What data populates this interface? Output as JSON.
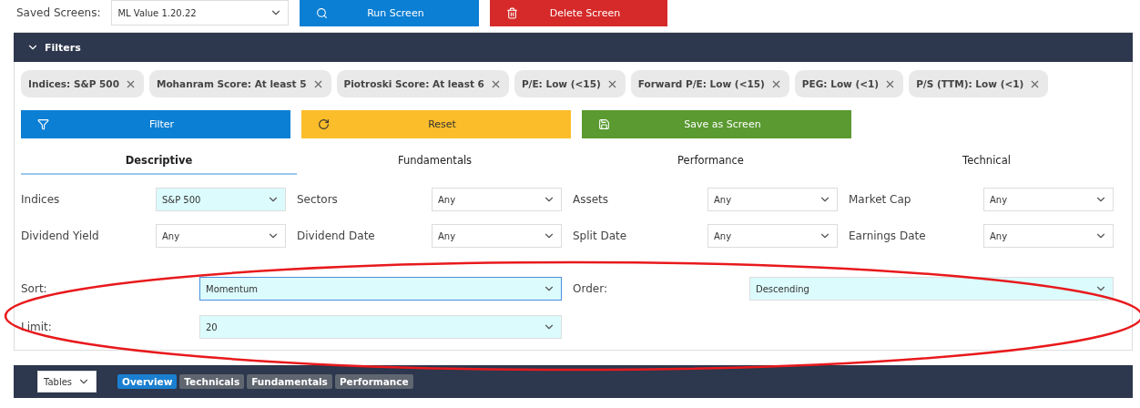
{
  "saved_screens": {
    "label": "Saved Screens:",
    "value": "ML Value 1.20.22"
  },
  "top_buttons": [
    {
      "label": "Run Screen",
      "kind": "run"
    },
    {
      "label": "Delete Screen",
      "kind": "delete"
    }
  ],
  "filters_bar": {
    "title": "Filters",
    "expanded": true
  },
  "chips": [
    {
      "label": "Indices: S&P 500"
    },
    {
      "label": "Mohanram Score: At least 5"
    },
    {
      "label": "Piotroski Score: At least 6"
    },
    {
      "label": "P/E: Low (<15)"
    },
    {
      "label": "Forward P/E: Low (<15)"
    },
    {
      "label": "PEG: Low (<1)"
    },
    {
      "label": "P/S (TTM): Low (<1)"
    }
  ],
  "action_buttons": [
    {
      "label": "Filter",
      "kind": "filter"
    },
    {
      "label": "Reset",
      "kind": "reset"
    },
    {
      "label": "Save as Screen",
      "kind": "save"
    }
  ],
  "tabs": [
    {
      "label": "Descriptive",
      "selected": true
    },
    {
      "label": "Fundamentals",
      "selected": false
    },
    {
      "label": "Performance",
      "selected": false
    },
    {
      "label": "Technical",
      "selected": false
    }
  ],
  "fields": [
    {
      "label": "Indices",
      "value": "S&P 500",
      "highlighted": true
    },
    {
      "label": "Sectors",
      "value": "Any",
      "highlighted": false
    },
    {
      "label": "Assets",
      "value": "Any",
      "highlighted": false
    },
    {
      "label": "Market Cap",
      "value": "Any",
      "highlighted": false
    },
    {
      "label": "Dividend Yield",
      "value": "Any",
      "highlighted": false
    },
    {
      "label": "Dividend Date",
      "value": "Any",
      "highlighted": false
    },
    {
      "label": "Split Date",
      "value": "Any",
      "highlighted": false
    },
    {
      "label": "Earnings Date",
      "value": "Any",
      "highlighted": false
    }
  ],
  "sort_fields": [
    {
      "label": "Sort:",
      "value": "Momentum",
      "highlighted": true,
      "focused": true
    },
    {
      "label": "Order:",
      "value": "Descending",
      "highlighted": true,
      "focused": false
    },
    {
      "label": "Limit:",
      "value": "20",
      "highlighted": true,
      "focused": false
    }
  ],
  "bottom_bar": {
    "tables_select": "Tables",
    "tabs": [
      {
        "label": "Overview",
        "selected": true
      },
      {
        "label": "Technicals",
        "selected": false
      },
      {
        "label": "Fundamentals",
        "selected": false
      },
      {
        "label": "Performance",
        "selected": false
      }
    ]
  },
  "annotation": {
    "kind": "ellipse",
    "color": "#e8191c"
  }
}
